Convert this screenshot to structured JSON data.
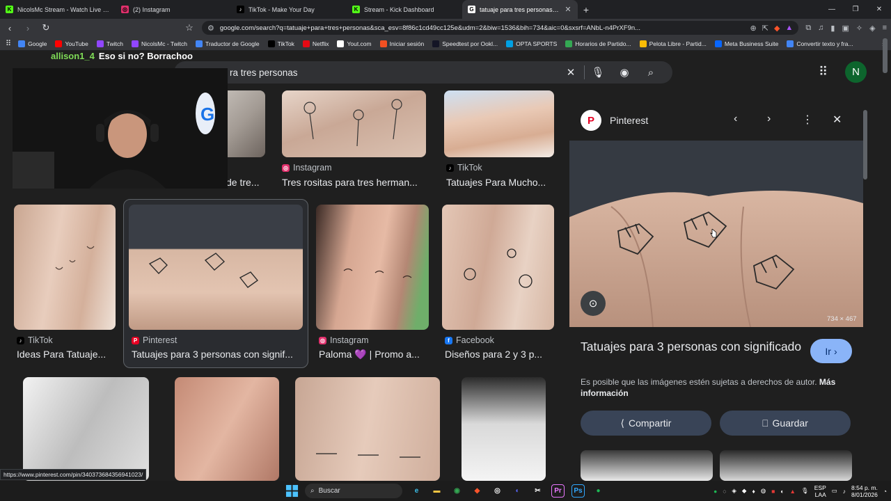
{
  "tabs": [
    {
      "title": "NicolsMc Stream - Watch Live on Kick",
      "favicon_color": "#53fc18",
      "favicon_glyph": "K",
      "active": false
    },
    {
      "title": "(2) Instagram",
      "favicon_color": "#e1306c",
      "favicon_glyph": "◎",
      "active": false
    },
    {
      "title": "TikTok - Make Your Day",
      "favicon_color": "#000000",
      "favicon_glyph": "♪",
      "active": false
    },
    {
      "title": "Stream - Kick Dashboard",
      "favicon_color": "#53fc18",
      "favicon_glyph": "K",
      "active": false
    },
    {
      "title": "tatuaje para tres personas - Buscar",
      "favicon_color": "#ffffff",
      "favicon_glyph": "G",
      "active": true
    }
  ],
  "address": {
    "url": "google.com/search?q=tatuaje+para+tres+personas&sca_esv=8f86c1cd49cc125e&udm=2&biw=1536&bih=734&aic=0&sxsrf=ANbL-n4PrXF9n..."
  },
  "bookmarks": [
    {
      "label": "Google",
      "color": "#4285f4"
    },
    {
      "label": "YouTube",
      "color": "#ff0000"
    },
    {
      "label": "Twitch",
      "color": "#9146ff"
    },
    {
      "label": "NicolsMc - Twitch",
      "color": "#9146ff"
    },
    {
      "label": "Traductor de Google",
      "color": "#4285f4"
    },
    {
      "label": "TikTok",
      "color": "#000000"
    },
    {
      "label": "Netflix",
      "color": "#e50914"
    },
    {
      "label": "Yout.com",
      "color": "#ffffff"
    },
    {
      "label": "Iniciar sesión",
      "color": "#f25022"
    },
    {
      "label": "Speedtest por Ookl...",
      "color": "#141526"
    },
    {
      "label": "OPTA SPORTS",
      "color": "#00a0e3"
    },
    {
      "label": "Horarios de Partido...",
      "color": "#34a853"
    },
    {
      "label": "Pelota Libre - Partid...",
      "color": "#fbbc05"
    },
    {
      "label": "Meta Business Suite",
      "color": "#0866ff"
    },
    {
      "label": "Convertir texto y fra...",
      "color": "#4285f4"
    }
  ],
  "chat": {
    "user": "allison1_4",
    "message": "Eso si no? Borrachoo"
  },
  "search": {
    "query": "tatuaje para tres personas",
    "visible_query": "ra tres personas"
  },
  "profile_initial": "N",
  "results": {
    "row1": [
      {
        "source": "",
        "caption": "de tre..."
      },
      {
        "source": "Instagram",
        "caption": "Tres rositas para tres herman..."
      },
      {
        "source": "TikTok",
        "caption": "Tatuajes Para Mucho..."
      }
    ],
    "row2": [
      {
        "source": "TikTok",
        "caption": "Ideas Para Tatuaje..."
      },
      {
        "source": "Pinterest",
        "caption": "Tatuajes para 3 personas con signif..."
      },
      {
        "source": "Instagram",
        "caption": "Paloma 💜 | Promo a..."
      },
      {
        "source": "Facebook",
        "caption": "Diseños para 2 y 3 p..."
      }
    ]
  },
  "panel": {
    "source": "Pinterest",
    "dimensions": "734 × 467",
    "title": "Tatuajes para 3 personas con significado",
    "go_label": "Ir",
    "copyright": "Es posible que las imágenes estén sujetas a derechos de autor.",
    "more_info": "Más información",
    "share_label": "Compartir",
    "save_label": "Guardar"
  },
  "status_url": "https://www.pinterest.com/pin/340373684356941023/",
  "taskbar": {
    "search_placeholder": "Buscar",
    "lang_top": "ESP",
    "lang_bottom": "LAA",
    "time": "8:54 p. m.",
    "date": "8/01/2026"
  }
}
